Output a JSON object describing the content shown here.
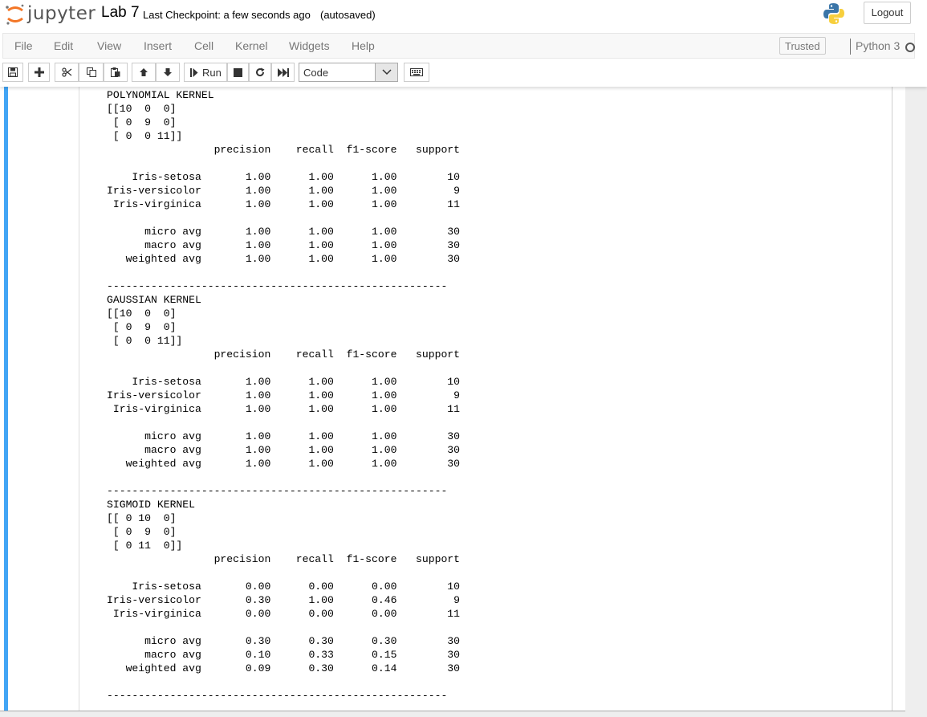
{
  "header": {
    "logo_text": "jupyter",
    "notebook_name": "Lab 7",
    "checkpoint": "Last Checkpoint: a few seconds ago",
    "autosave_status": "(autosaved)",
    "logout_label": "Logout"
  },
  "menubar": {
    "items": [
      "File",
      "Edit",
      "View",
      "Insert",
      "Cell",
      "Kernel",
      "Widgets",
      "Help"
    ],
    "trusted_label": "Trusted",
    "kernel_name": "Python 3"
  },
  "toolbar": {
    "run_label": "Run",
    "cell_type": "Code"
  },
  "output": {
    "text": "POLYNOMIAL KERNEL\n[[10  0  0]\n [ 0  9  0]\n [ 0  0 11]]\n                 precision    recall  f1-score   support\n\n    Iris-setosa       1.00      1.00      1.00        10\nIris-versicolor       1.00      1.00      1.00         9\n Iris-virginica       1.00      1.00      1.00        11\n\n      micro avg       1.00      1.00      1.00        30\n      macro avg       1.00      1.00      1.00        30\n   weighted avg       1.00      1.00      1.00        30\n\n------------------------------------------------------\nGAUSSIAN KERNEL\n[[10  0  0]\n [ 0  9  0]\n [ 0  0 11]]\n                 precision    recall  f1-score   support\n\n    Iris-setosa       1.00      1.00      1.00        10\nIris-versicolor       1.00      1.00      1.00         9\n Iris-virginica       1.00      1.00      1.00        11\n\n      micro avg       1.00      1.00      1.00        30\n      macro avg       1.00      1.00      1.00        30\n   weighted avg       1.00      1.00      1.00        30\n\n------------------------------------------------------\nSIGMOID KERNEL\n[[ 0 10  0]\n [ 0  9  0]\n [ 0 11  0]]\n                 precision    recall  f1-score   support\n\n    Iris-setosa       0.00      0.00      0.00        10\nIris-versicolor       0.30      1.00      0.46         9\n Iris-virginica       0.00      0.00      0.00        11\n\n      micro avg       0.30      0.30      0.30        30\n      macro avg       0.10      0.33      0.15        30\n   weighted avg       0.09      0.30      0.14        30\n\n------------------------------------------------------"
  },
  "colors": {
    "cell_selected_border": "#42a5f5",
    "jupyter_orange": "#f37626"
  }
}
